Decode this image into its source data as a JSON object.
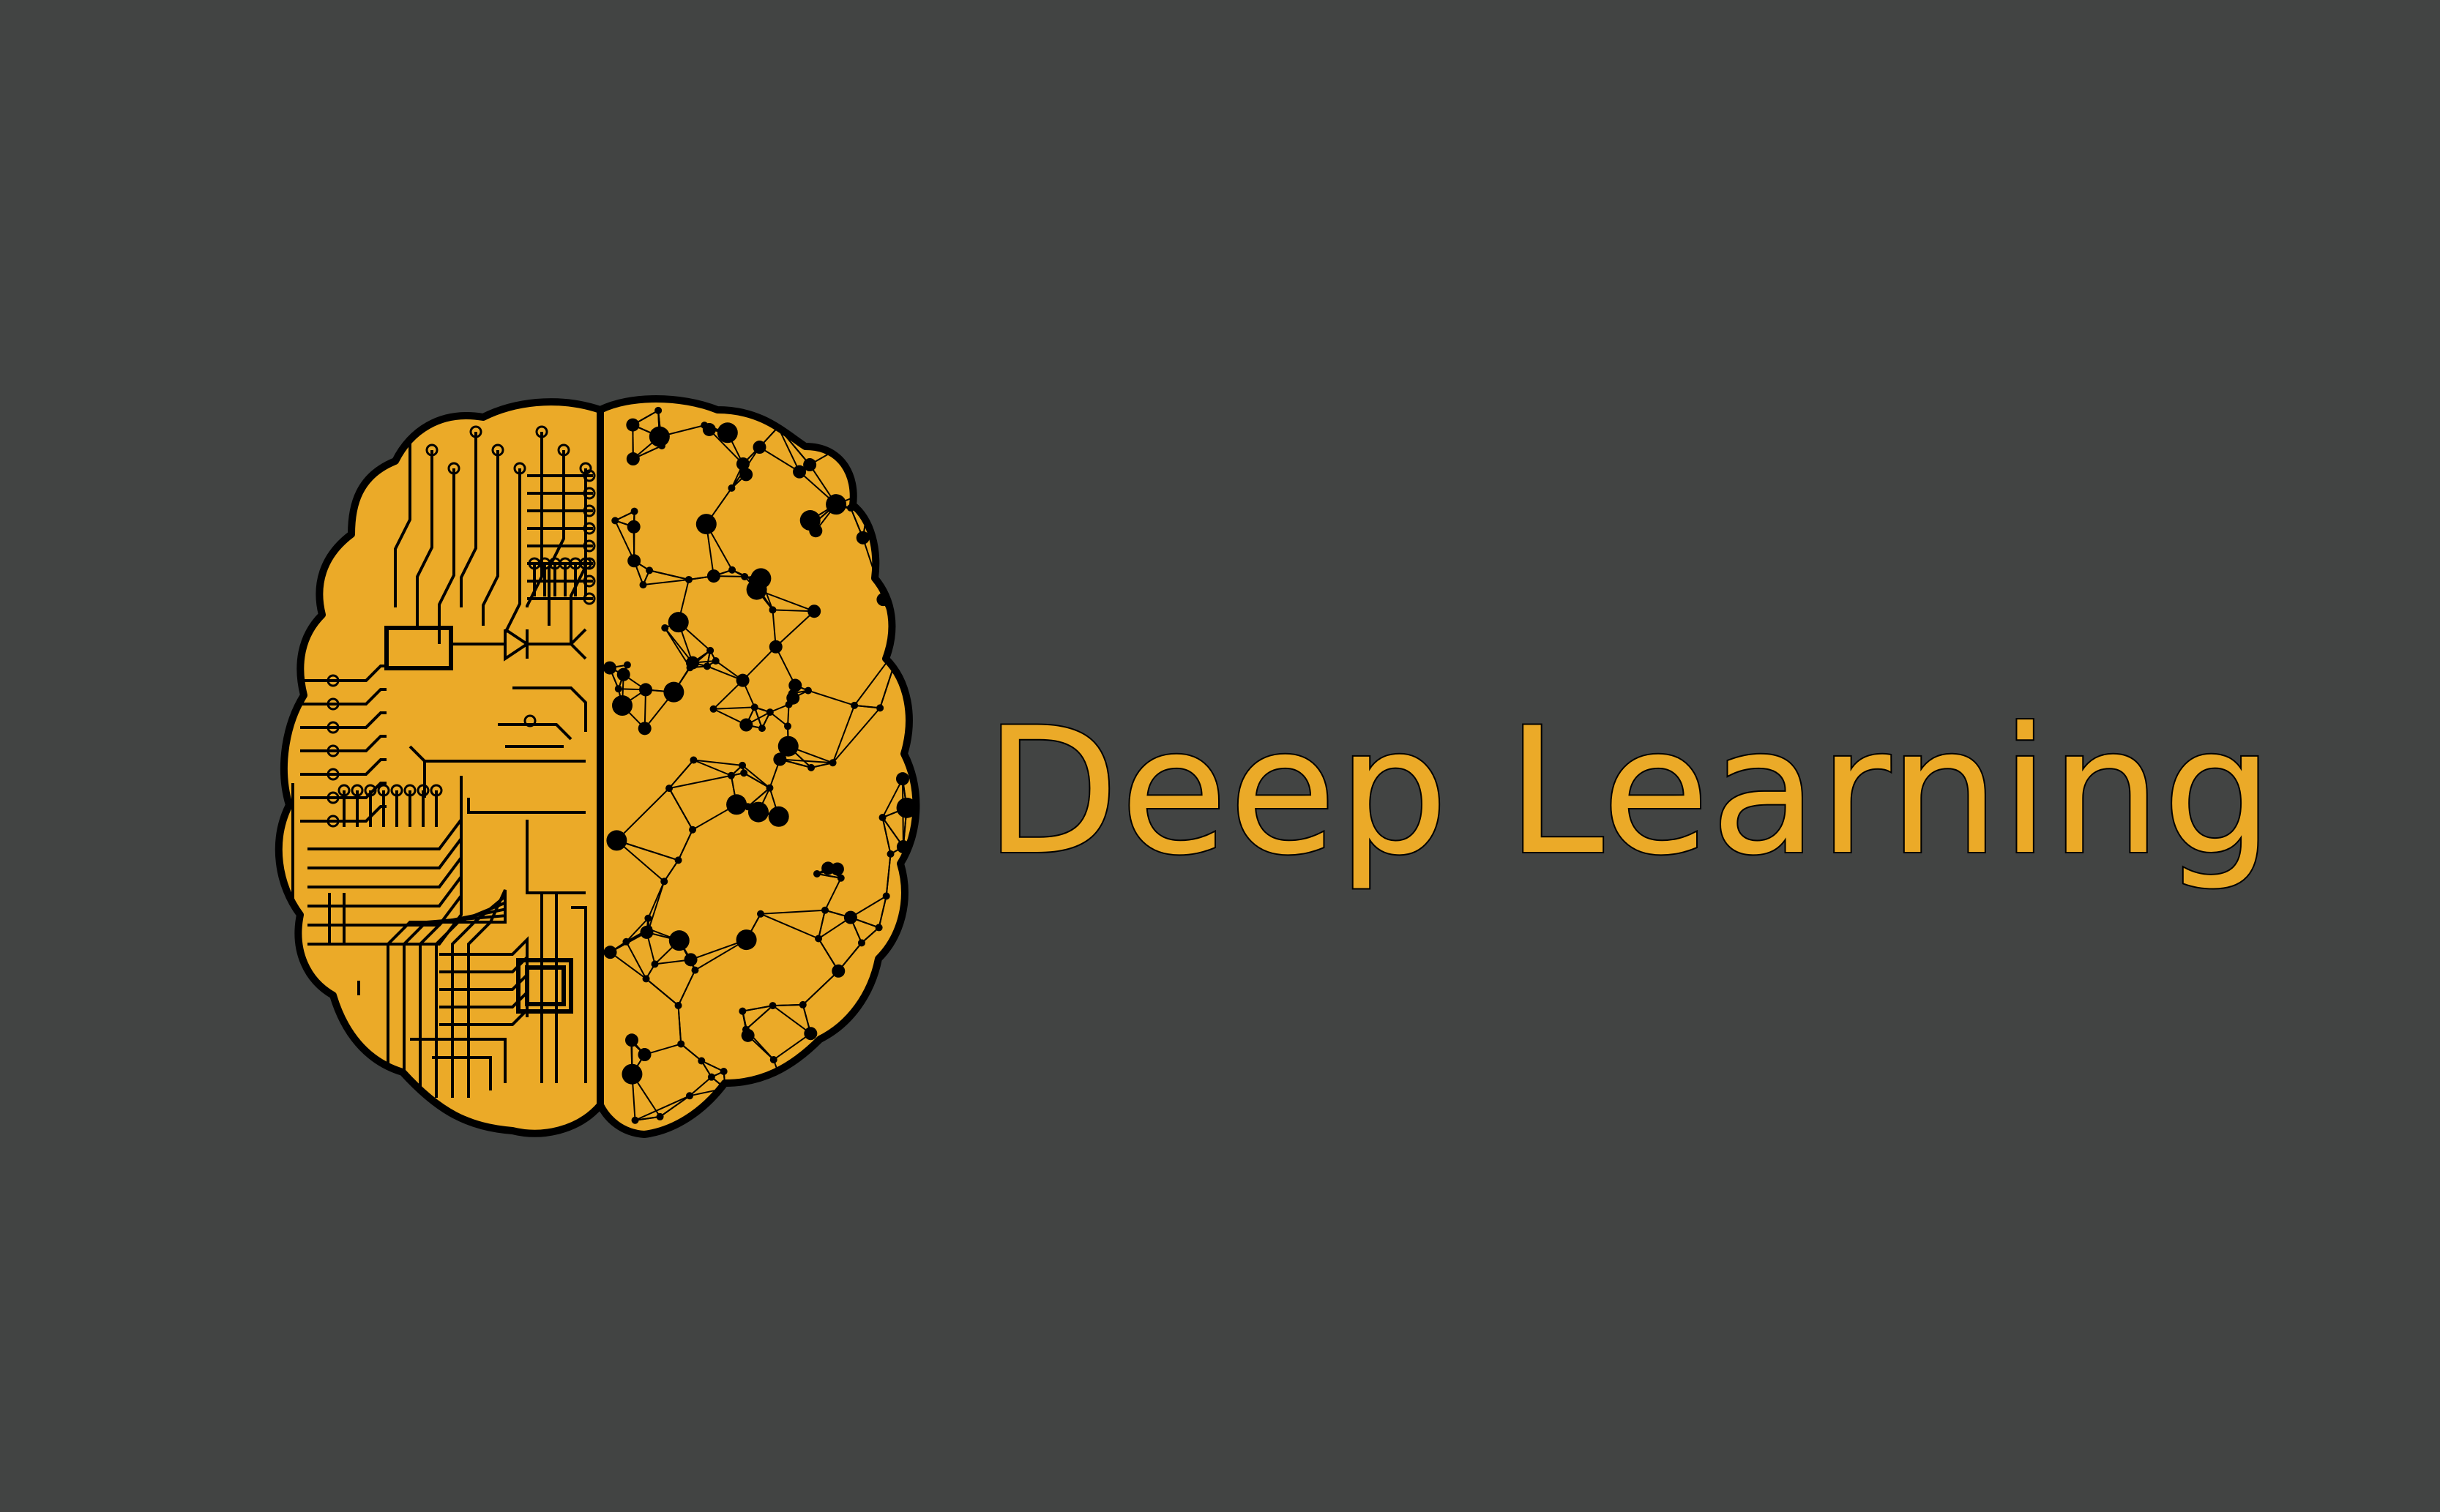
{
  "title": "Deep Learning",
  "logo": {
    "icon": "circuit-neural-brain-icon"
  },
  "colors": {
    "background": "#424443",
    "accent": "#EBAA28",
    "outline": "#000000"
  }
}
